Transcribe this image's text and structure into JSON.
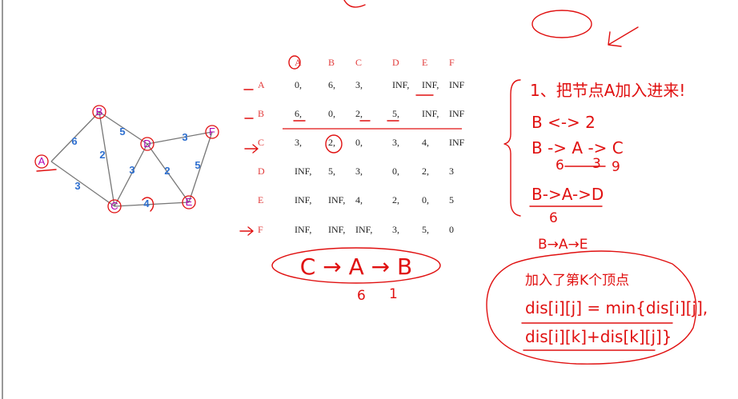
{
  "graph": {
    "nodes": [
      {
        "id": "A",
        "color": "#b000b0"
      },
      {
        "id": "B",
        "color": "#b000b0"
      },
      {
        "id": "C",
        "color": "#b000b0"
      },
      {
        "id": "D",
        "color": "#b000b0"
      },
      {
        "id": "E",
        "color": "#b000b0"
      },
      {
        "id": "F",
        "color": "#b000b0"
      }
    ],
    "edges": [
      {
        "from": "A",
        "to": "B",
        "weight": "6"
      },
      {
        "from": "A",
        "to": "C",
        "weight": "3"
      },
      {
        "from": "B",
        "to": "C",
        "weight": "2"
      },
      {
        "from": "B",
        "to": "D",
        "weight": "5"
      },
      {
        "from": "C",
        "to": "D",
        "weight": "3"
      },
      {
        "from": "C",
        "to": "E",
        "weight": "4"
      },
      {
        "from": "D",
        "to": "E",
        "weight": "2"
      },
      {
        "from": "D",
        "to": "F",
        "weight": "3"
      },
      {
        "from": "E",
        "to": "F",
        "weight": "5"
      }
    ]
  },
  "matrix": {
    "headers": [
      "A",
      "B",
      "C",
      "D",
      "E",
      "F"
    ],
    "rows": [
      {
        "label": "A",
        "cells": [
          "0,",
          "6,",
          "3,",
          "INF,",
          "INF,",
          "INF"
        ]
      },
      {
        "label": "B",
        "cells": [
          "6,",
          "0,",
          "2,",
          "5,",
          "INF,",
          "INF"
        ]
      },
      {
        "label": "C",
        "cells": [
          "3,",
          "2,",
          "0,",
          "3,",
          "4,",
          "INF"
        ]
      },
      {
        "label": "D",
        "cells": [
          "INF,",
          "5,",
          "3,",
          "0,",
          "2,",
          "3"
        ]
      },
      {
        "label": "E",
        "cells": [
          "INF,",
          "INF,",
          "4,",
          "2,",
          "0,",
          "5"
        ]
      },
      {
        "label": "F",
        "cells": [
          "INF,",
          "INF,",
          "INF,",
          "3,",
          "5,",
          "0"
        ]
      }
    ]
  },
  "scribbles": {
    "path_oval": "C → A → B",
    "oval_numbers": [
      "6",
      "1"
    ]
  },
  "notes": {
    "step_title": "1、把节点A加入进来!",
    "line1": "B <-> 2",
    "line2": "B -> A -> C",
    "line2_sub": [
      "6",
      "3",
      "9"
    ],
    "line3": "B->A->D",
    "line3_sub": "6",
    "line4": "B→A→E",
    "formula_title": "加入了第K个顶点",
    "formula_line1": "dis[i][j] = min{dis[i][j],",
    "formula_line2": "dis[i][k]+dis[k][j]}"
  },
  "colors": {
    "annotation_red": "#e01010",
    "weight_blue": "#2e6fcf",
    "node_purple": "#b000b0"
  }
}
